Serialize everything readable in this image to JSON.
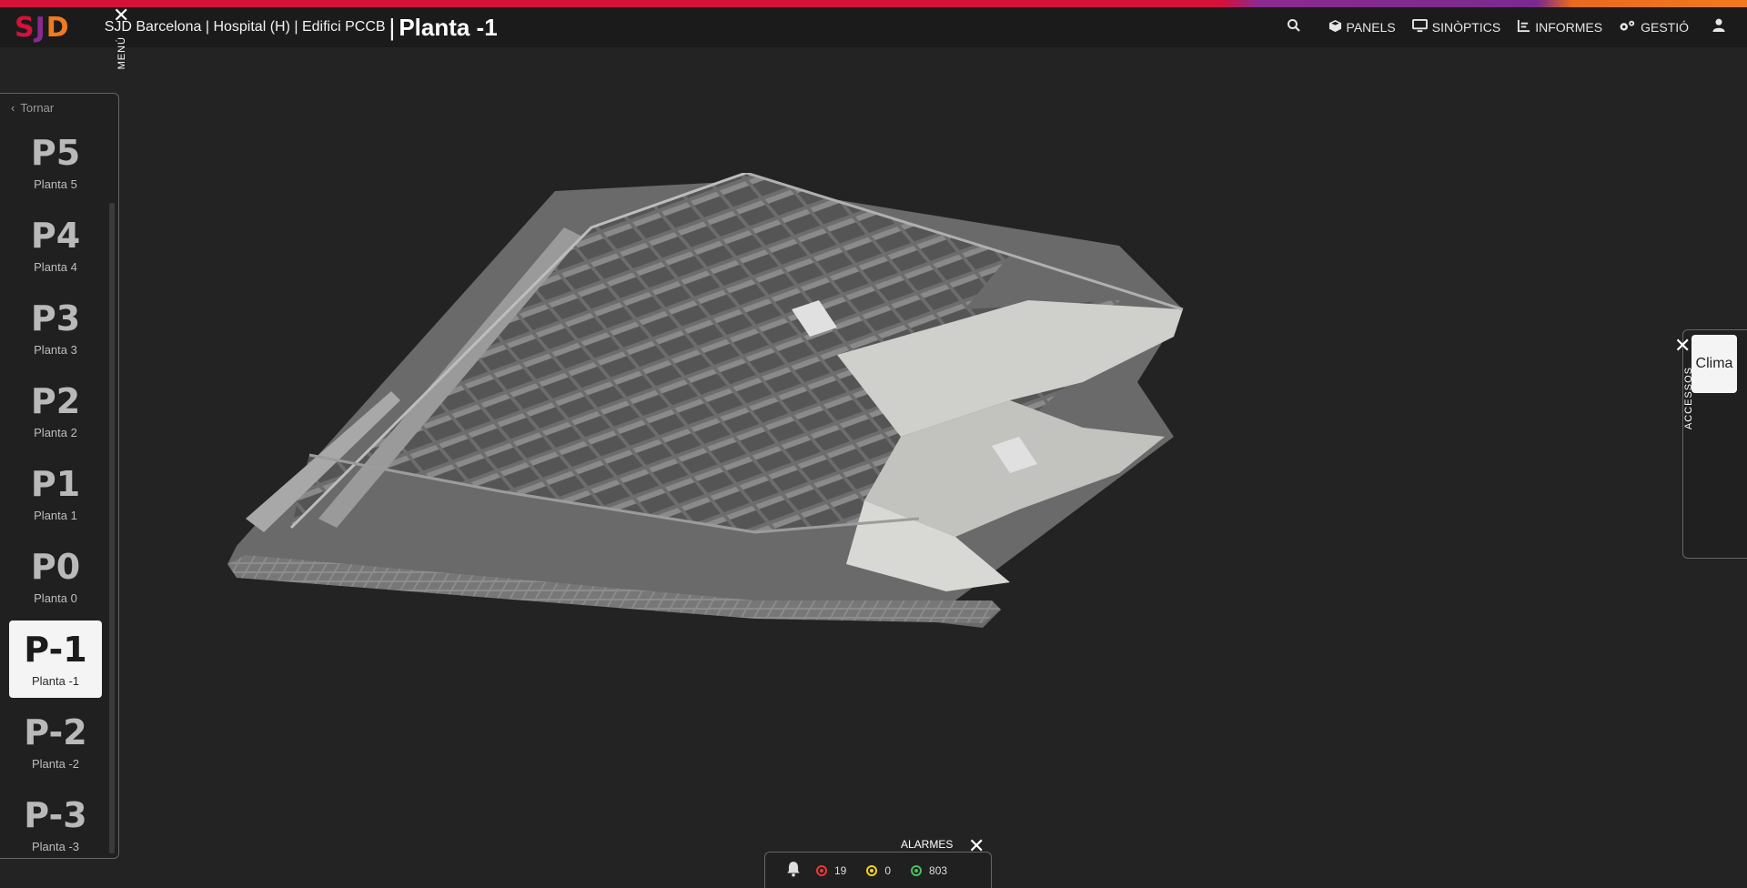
{
  "header": {
    "logo": {
      "s": "S",
      "j": "J",
      "d": "D"
    },
    "breadcrumb": "SJD Barcelona | Hospital (H) | Edifici PCCB",
    "separator": "|",
    "title": "Planta -1",
    "nav": [
      {
        "label": "PANELS",
        "icon": "cube-icon"
      },
      {
        "label": "SINÒPTICS",
        "icon": "monitor-icon"
      },
      {
        "label": "INFORMES",
        "icon": "report-icon"
      },
      {
        "label": "GESTIÓ",
        "icon": "gears-icon"
      }
    ]
  },
  "floor_menu": {
    "back_label": "Tornar",
    "menu_label": "MENÚ",
    "floors": [
      {
        "code": "P5",
        "name": "Planta 5",
        "active": false
      },
      {
        "code": "P4",
        "name": "Planta 4",
        "active": false
      },
      {
        "code": "P3",
        "name": "Planta 3",
        "active": false
      },
      {
        "code": "P2",
        "name": "Planta 2",
        "active": false
      },
      {
        "code": "P1",
        "name": "Planta 1",
        "active": false
      },
      {
        "code": "P0",
        "name": "Planta 0",
        "active": false
      },
      {
        "code": "P-1",
        "name": "Planta -1",
        "active": true
      },
      {
        "code": "P-2",
        "name": "Planta -2",
        "active": false
      },
      {
        "code": "P-3",
        "name": "Planta -3",
        "active": false
      }
    ]
  },
  "access_panel": {
    "label": "ACCESSOS",
    "button": "Clima"
  },
  "alarms": {
    "title": "ALARMES",
    "red_count": "19",
    "yellow_count": "0",
    "green_count": "803",
    "colors": {
      "red": "#e53935",
      "yellow": "#f2d21b",
      "green": "#43c35a"
    }
  },
  "colors": {
    "brand_red": "#d4123a",
    "brand_purple": "#8a2a8f",
    "brand_orange": "#f07a20",
    "background": "#232323"
  }
}
